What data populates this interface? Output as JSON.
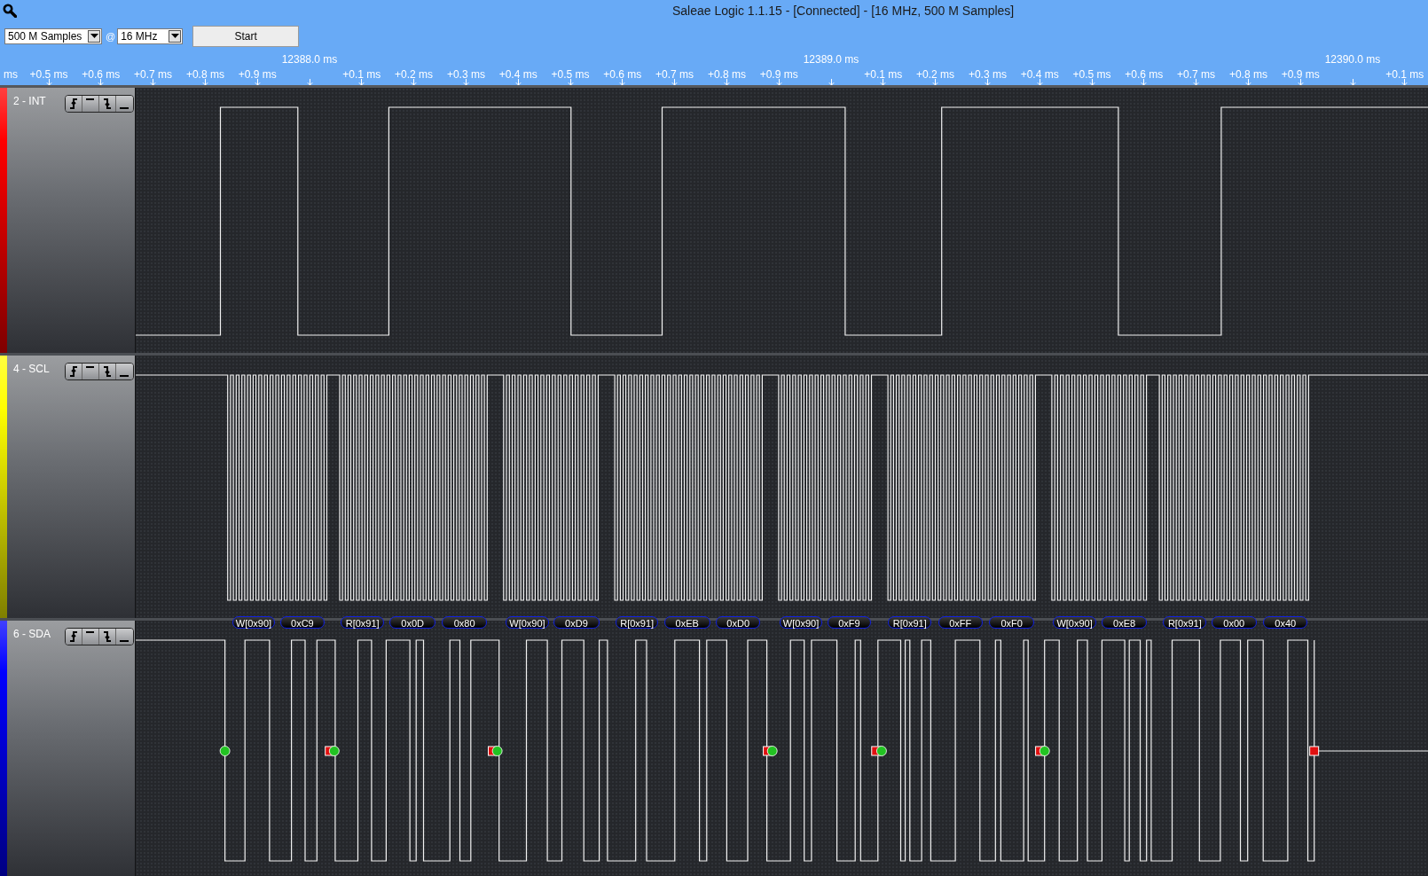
{
  "window": {
    "title": "Saleae Logic 1.1.15 - [Connected] - [16 MHz, 500 M Samples]"
  },
  "toolbar": {
    "sample_count": "500 M Samples",
    "at_sign": "@",
    "sample_rate": "16 MHz",
    "start_button": "Start"
  },
  "ruler": {
    "major": [
      "12388.0 ms",
      "12389.0 ms",
      "12390.0 ms"
    ],
    "minor": [
      "ms",
      "+0.5 ms",
      "+0.6 ms",
      "+0.7 ms",
      "+0.8 ms",
      "+0.9 ms",
      "+0.1 ms",
      "+0.2 ms",
      "+0.3 ms",
      "+0.4 ms",
      "+0.5 ms",
      "+0.6 ms",
      "+0.7 ms",
      "+0.8 ms",
      "+0.9 ms",
      "+0.1 ms",
      "+0.2 ms",
      "+0.3 ms",
      "+0.4 ms",
      "+0.5 ms",
      "+0.6 ms",
      "+0.7 ms",
      "+0.8 ms",
      "+0.9 ms",
      "+0.1 ms"
    ]
  },
  "channels": [
    {
      "name": "2 - INT",
      "color": "#ff0000",
      "kind": "interrupt"
    },
    {
      "name": "4 - SCL",
      "color": "#ffff00",
      "kind": "clock"
    },
    {
      "name": "6 - SDA",
      "color": "#0000ff",
      "kind": "data",
      "decoded": [
        "W[0x90]",
        "0xC9",
        "R[0x91]",
        "0x0D",
        "0x80",
        "W[0x90]",
        "0xD9",
        "R[0x91]",
        "0xEB",
        "0xD0",
        "W[0x90]",
        "0xF9",
        "R[0x91]",
        "0xFF",
        "0xF0",
        "W[0x90]",
        "0xE8",
        "R[0x91]",
        "0x00",
        "0x40"
      ]
    }
  ]
}
